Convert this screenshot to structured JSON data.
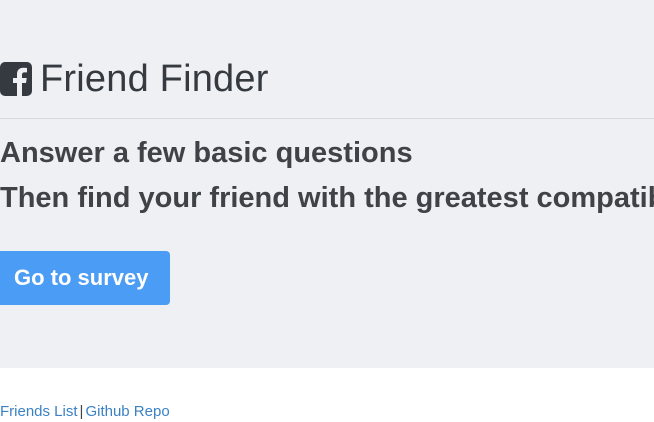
{
  "header": {
    "icon": "facebook-square-icon",
    "title": "Friend Finder"
  },
  "intro": {
    "line1": "Answer a few basic questions",
    "line2": "Then find your friend with the greatest compatibility"
  },
  "cta": {
    "label": "Go to survey"
  },
  "footer": {
    "links": [
      {
        "label": "Friends List"
      },
      {
        "label": "Github Repo"
      }
    ],
    "separator": "|"
  },
  "colors": {
    "jumbotron_bg": "#eef0f4",
    "button_bg": "#4a9cf4",
    "link": "#3b82c4",
    "text": "#343a40"
  }
}
